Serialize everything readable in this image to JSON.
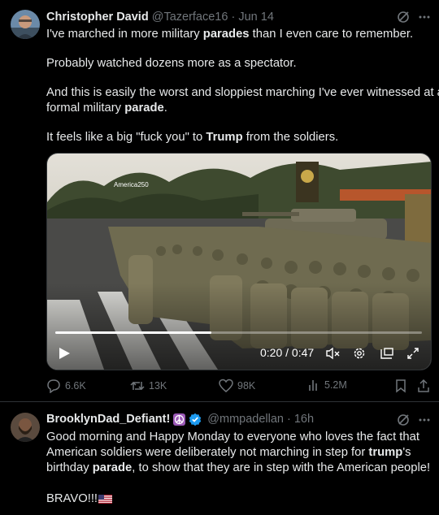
{
  "tweet1": {
    "author_name": "Christopher David",
    "handle": "@Tazerface16",
    "dot": "·",
    "date": "Jun 14",
    "paragraphs": [
      [
        {
          "t": "I've marched in more military "
        },
        {
          "b": "parades"
        },
        {
          "t": " than I even care to remember."
        }
      ],
      [
        {
          "t": "Probably watched dozens more as a spectator."
        }
      ],
      [
        {
          "t": "And this is easily the worst and sloppiest marching I've ever witnessed at a"
        }
      ],
      [
        {
          "t": "formal military "
        },
        {
          "b": "parade"
        },
        {
          "t": "."
        }
      ],
      [
        {
          "t": "It feels like a big \"fuck you\" to "
        },
        {
          "b": "Trump"
        },
        {
          "t": " from the soldiers."
        }
      ]
    ],
    "video": {
      "watermark": "America250",
      "time": "0:20 / 0:47",
      "progress": 0.425
    },
    "actions": {
      "replies": "6.6K",
      "reposts": "13K",
      "likes": "98K",
      "views": "5.2M"
    }
  },
  "tweet2": {
    "author_name": "BrooklynDad_Defiant!",
    "handle": "@mmpadellan",
    "dot": "·",
    "date": "16h",
    "lines": [
      [
        {
          "t": "Good morning and Happy Monday to everyone who loves the fact that"
        }
      ],
      [
        {
          "t": "American soldiers were deliberately not marching in step for "
        },
        {
          "b": "trump"
        },
        {
          "t": "'s"
        }
      ],
      [
        {
          "t": "birthday "
        },
        {
          "b": "parade"
        },
        {
          "t": ", to show that they are in step with the American people!"
        }
      ],
      [
        {
          "t": "BRAVO!!!"
        }
      ]
    ]
  },
  "colors": {
    "bg": "#000000",
    "muted": "#71767b",
    "text": "#e7e9ea",
    "verified": "#1d9bf0",
    "peace_bg": "#9b59b6"
  }
}
